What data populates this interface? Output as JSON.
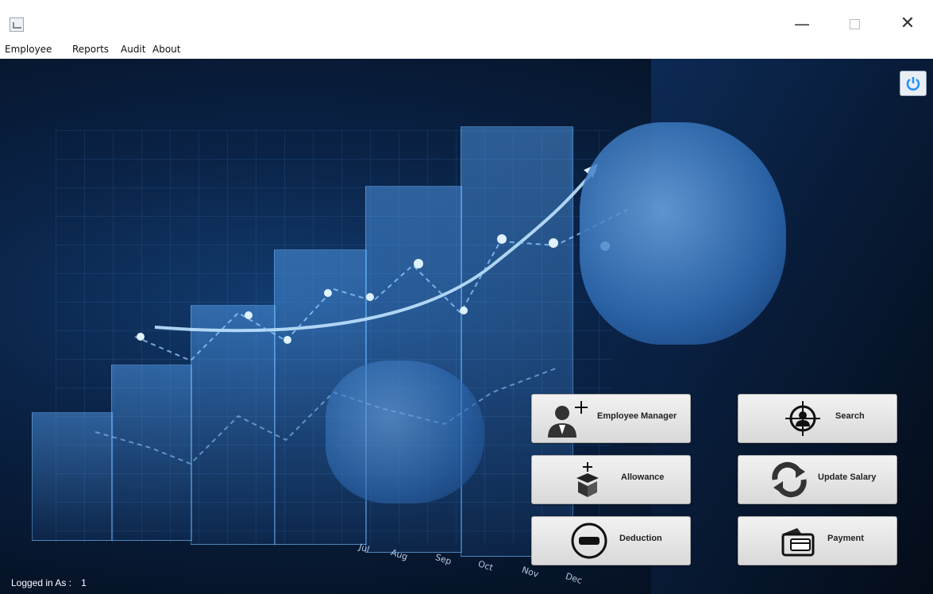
{
  "menu": {
    "items": [
      "Employee",
      "Reports",
      "Audit",
      "About"
    ]
  },
  "window_controls": {
    "minimize": "—",
    "close": "✕"
  },
  "background_months": [
    "Jul",
    "Aug",
    "Sep",
    "Oct",
    "Nov",
    "Dec"
  ],
  "buttons": {
    "employee_manager": "Employee Manager",
    "search": "Search",
    "allowance": "Allowance",
    "update_salary": "Update Salary",
    "deduction": "Deduction",
    "payment": "Payment"
  },
  "status": {
    "label": "Logged in As :",
    "value": "1"
  },
  "icons": {
    "app": "app-icon",
    "power": "power-icon",
    "employee_manager": "add-user-icon",
    "search": "crosshair-user-icon",
    "allowance": "add-box-icon",
    "update_salary": "refresh-icon",
    "deduction": "minus-circle-icon",
    "payment": "wallet-card-icon"
  },
  "colors": {
    "accent": "#1e90ff",
    "background": "#0a2347"
  }
}
